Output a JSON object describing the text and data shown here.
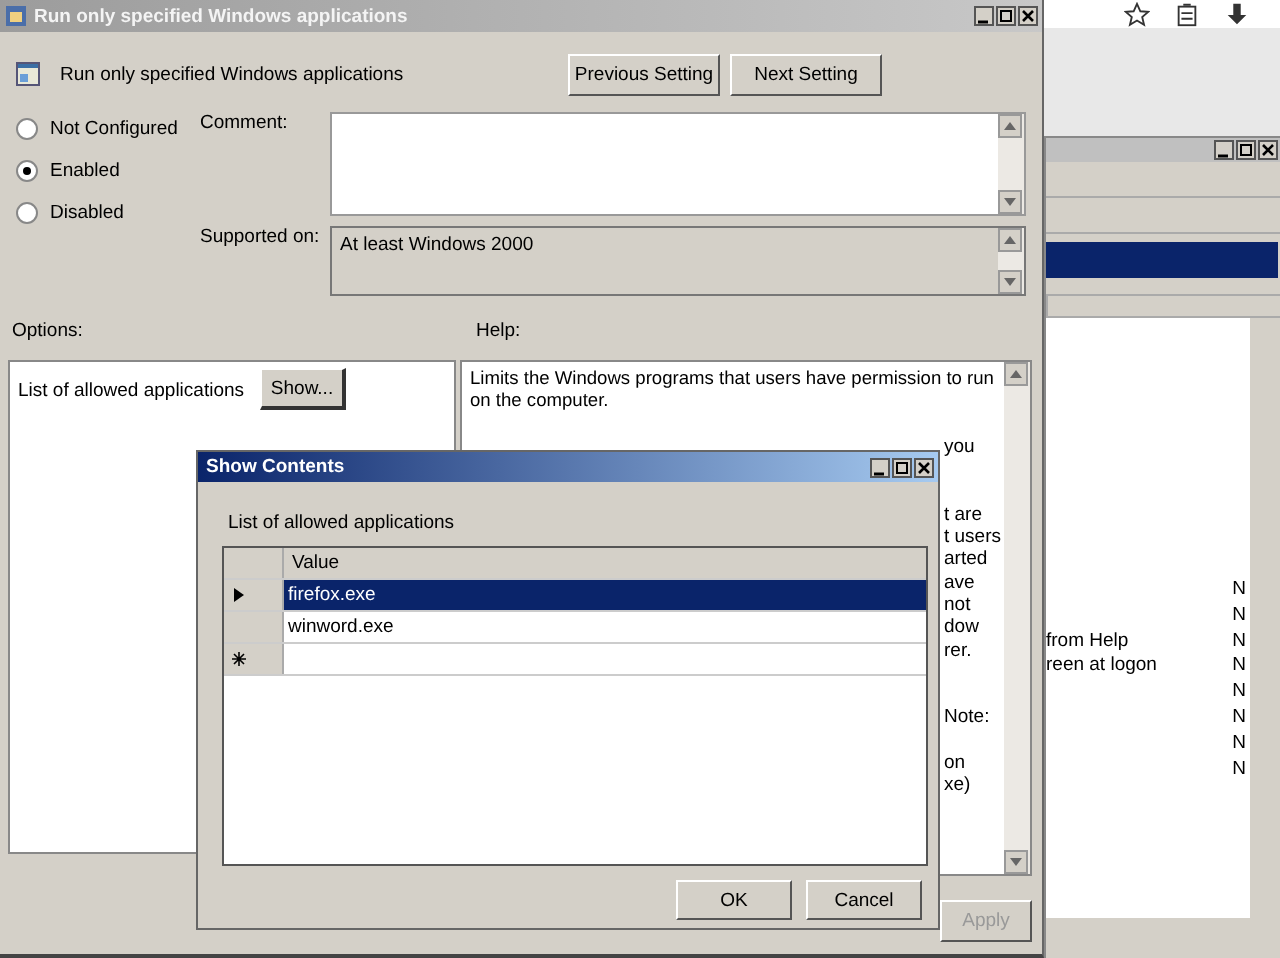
{
  "background_window": {
    "rows": [
      {
        "column_2": "N"
      },
      {
        "column_2": "N"
      },
      {
        "column_1": "from Help",
        "column_2": "N"
      },
      {
        "column_1": "reen at logon",
        "column_2": "N"
      },
      {
        "column_2": "N"
      },
      {
        "column_2": "N"
      },
      {
        "column_2": "N"
      },
      {
        "column_2": "N"
      }
    ]
  },
  "main_window": {
    "title": "Run only specified Windows applications",
    "heading": "Run only specified Windows applications",
    "buttons": [
      "Previous Setting",
      "Next Setting"
    ],
    "radios": [
      {
        "label": "Not Configured",
        "selected": false
      },
      {
        "label": "Enabled",
        "selected": true
      },
      {
        "label": "Disabled",
        "selected": false
      }
    ],
    "comment_label": "Comment:",
    "supported_label": "Supported on:",
    "supported_value": "At least Windows 2000",
    "options_label": "Options:",
    "help_label": "Help:",
    "option": {
      "label": "List of allowed applications",
      "button": "Show..."
    },
    "help_lines": [
      "Limits the Windows programs that users have permission to run",
      "on the computer."
    ],
    "help_partial_lines": [
      {
        "kind": "gap"
      },
      {
        "kind": "text",
        "text": "you"
      },
      {
        "kind": "gap"
      },
      {
        "kind": "gap"
      },
      {
        "kind": "text",
        "text": "t are"
      },
      {
        "kind": "text",
        "text": "t users"
      },
      {
        "kind": "text",
        "text": "arted"
      },
      {
        "kind": "text",
        "text": "ave"
      },
      {
        "kind": "text",
        "text": "not"
      },
      {
        "kind": "text",
        "text": "dow"
      },
      {
        "kind": "text",
        "text": "rer."
      },
      {
        "kind": "gap"
      },
      {
        "kind": "gap"
      },
      {
        "kind": "text",
        "text": "Note:"
      },
      {
        "kind": "gap"
      },
      {
        "kind": "text",
        "text": "on"
      },
      {
        "kind": "text",
        "text": "xe)"
      }
    ],
    "apply_button": {
      "label": "Apply",
      "disabled": true
    }
  },
  "dialog": {
    "title": "Show Contents",
    "label": "List of allowed applications",
    "column": "Value",
    "rows": [
      {
        "kind": "current",
        "value": "firefox.exe",
        "selected": true
      },
      {
        "kind": "normal",
        "value": "winword.exe",
        "selected": false
      },
      {
        "kind": "new",
        "selected": false
      }
    ],
    "buttons": [
      "OK",
      "Cancel"
    ]
  }
}
